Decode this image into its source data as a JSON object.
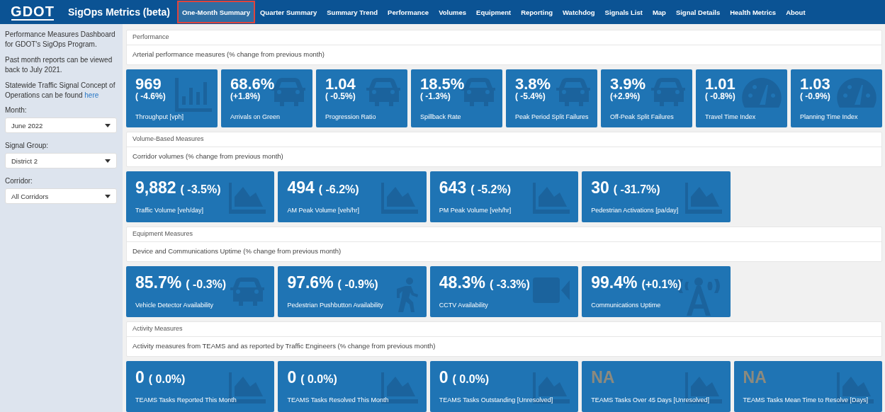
{
  "navbar": {
    "logo": "GDOT",
    "title": "SigOps Metrics (beta)",
    "tabs": [
      {
        "label": "One-Month Summary",
        "selected": true
      },
      {
        "label": "Quarter Summary",
        "selected": false
      },
      {
        "label": "Summary Trend",
        "selected": false
      },
      {
        "label": "Performance",
        "selected": false
      },
      {
        "label": "Volumes",
        "selected": false
      },
      {
        "label": "Equipment",
        "selected": false
      },
      {
        "label": "Reporting",
        "selected": false
      },
      {
        "label": "Watchdog",
        "selected": false
      },
      {
        "label": "Signals List",
        "selected": false
      },
      {
        "label": "Map",
        "selected": false
      },
      {
        "label": "Signal Details",
        "selected": false
      },
      {
        "label": "Health Metrics",
        "selected": false
      },
      {
        "label": "About",
        "selected": false
      }
    ]
  },
  "sidebar": {
    "paragraphs": [
      "Performance Measures Dashboard for GDOT's SigOps Program.",
      "Past month reports can be viewed back to July 2021."
    ],
    "concept_text": "Statewide Traffic Signal Concept of Operations can be found",
    "concept_link": "here",
    "fields": [
      {
        "label": "Month:",
        "value": "June 2022"
      },
      {
        "label": "Signal Group:",
        "value": "District 2"
      },
      {
        "label": "Corridor:",
        "value": "All Corridors"
      }
    ]
  },
  "sections": [
    {
      "title": "Performance",
      "description": "Arterial performance measures (% change from previous month)",
      "kind": "stacked",
      "cards": [
        {
          "value": "969",
          "change": "( -4.6%)",
          "label": "Throughput [vph]",
          "dimmed": false
        },
        {
          "value": "68.6%",
          "change": "(+1.8%)",
          "label": "Arrivals on Green",
          "dimmed": false
        },
        {
          "value": "1.04",
          "change": "( -0.5%)",
          "label": "Progression Ratio",
          "dimmed": false
        },
        {
          "value": "18.5%",
          "change": "( -1.3%)",
          "label": "Spillback Rate",
          "dimmed": false
        },
        {
          "value": "3.8%",
          "change": "( -5.4%)",
          "label": "Peak Period Split Failures",
          "dimmed": false
        },
        {
          "value": "3.9%",
          "change": "(+2.9%)",
          "label": "Off-Peak Split Failures",
          "dimmed": false
        },
        {
          "value": "1.01",
          "change": "( -0.8%)",
          "label": "Travel Time Index",
          "dimmed": false
        },
        {
          "value": "1.03",
          "change": "( -0.9%)",
          "label": "Planning Time Index",
          "dimmed": false
        }
      ]
    },
    {
      "title": "Volume-Based Measures",
      "description": "Corridor volumes (% change from previous month)",
      "kind": "inline",
      "cards": [
        {
          "value": "9,882",
          "change": "( -3.5%)",
          "label": "Traffic Volume [veh/day]",
          "dimmed": false
        },
        {
          "value": "494",
          "change": "( -6.2%)",
          "label": "AM Peak Volume [veh/hr]",
          "dimmed": false
        },
        {
          "value": "643",
          "change": "( -5.2%)",
          "label": "PM Peak Volume [veh/hr]",
          "dimmed": false
        },
        {
          "value": "30",
          "change": "( -31.7%)",
          "label": "Pedestrian Activations [pa/day]",
          "dimmed": false
        }
      ]
    },
    {
      "title": "Equipment Measures",
      "description": "Device and Communications Uptime (% change from previous month)",
      "kind": "inline",
      "cards": [
        {
          "value": "85.7%",
          "change": "( -0.3%)",
          "label": "Vehicle Detector Availability",
          "dimmed": false
        },
        {
          "value": "97.6%",
          "change": "( -0.9%)",
          "label": "Pedestrian Pushbutton Availability",
          "dimmed": false
        },
        {
          "value": "48.3%",
          "change": "( -3.3%)",
          "label": "CCTV Availability",
          "dimmed": false
        },
        {
          "value": "99.4%",
          "change": "(+0.1%)",
          "label": "Communications Uptime",
          "dimmed": false
        }
      ]
    },
    {
      "title": "Activity Measures",
      "description": "Activity measures from TEAMS and as reported by Traffic Engineers (% change from previous month)",
      "kind": "inline",
      "cards": [
        {
          "value": "0",
          "change": "( 0.0%)",
          "label": "TEAMS Tasks Reported This Month",
          "dimmed": false
        },
        {
          "value": "0",
          "change": "( 0.0%)",
          "label": "TEAMS Tasks Resolved This Month",
          "dimmed": false
        },
        {
          "value": "0",
          "change": "( 0.0%)",
          "label": "TEAMS Tasks Outstanding [Unresolved]",
          "dimmed": false
        },
        {
          "value": "NA",
          "label": "TEAMS Tasks Over 45 Days [Unresolved]",
          "dimmed": true
        },
        {
          "value": "NA",
          "label": "TEAMS Tasks Mean Time to Resolve [Days]",
          "dimmed": true
        }
      ]
    }
  ]
}
